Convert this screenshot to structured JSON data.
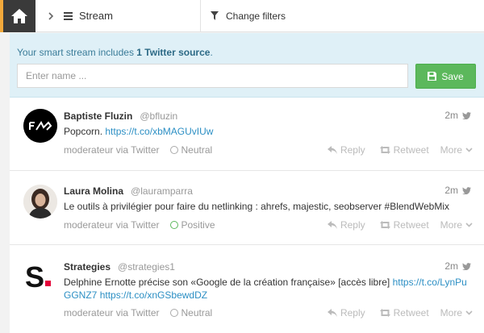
{
  "topbar": {
    "stream_label": "Stream",
    "filters_label": "Change filters",
    "accent": "#f2a93b"
  },
  "panel": {
    "info_prefix": "Your smart stream includes",
    "info_highlight": "1 Twitter source",
    "info_suffix": ".",
    "name_placeholder": "Enter name ...",
    "save_label": "Save"
  },
  "posts": [
    {
      "author": "Baptiste Fluzin",
      "handle": "@bfluzin",
      "time": "2m",
      "text": "Popcorn.",
      "link1": "https://t.co/xbMAGUvIUw",
      "text2": "",
      "link2": "",
      "source": "moderateur via Twitter",
      "sentiment": "Neutral",
      "reply": "Reply",
      "retweet": "Retweet",
      "more": "More"
    },
    {
      "author": "Laura Molina",
      "handle": "@lauramparra",
      "time": "2m",
      "text": "Le outils à privilégier pour faire du netlinking : ahrefs, majestic, seobserver #BlendWebMix",
      "link1": "",
      "text2": "",
      "link2": "",
      "source": "moderateur via Twitter",
      "sentiment": "Positive",
      "reply": "Reply",
      "retweet": "Retweet",
      "more": "More"
    },
    {
      "author": "Strategies",
      "handle": "@strategies1",
      "time": "2m",
      "text": "Delphine Ernotte précise son «Google de la création française» [accès libre]",
      "link1": "https://t.co/LynPuGGNZ7",
      "text2": "",
      "link2": "https://t.co/xnGSbewdDZ",
      "source": "moderateur via Twitter",
      "sentiment": "Neutral",
      "reply": "Reply",
      "retweet": "Retweet",
      "more": "More"
    }
  ]
}
